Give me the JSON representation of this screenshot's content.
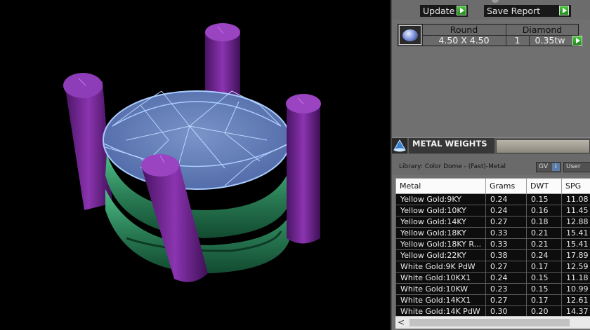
{
  "toolbar": {
    "update_label": "Update",
    "save_report_label": "Save Report"
  },
  "stone": {
    "shape": "Round",
    "type": "Diamond",
    "size": "4.50 X 4.50",
    "quantity": "1",
    "weight": "0.35tw"
  },
  "metal_weights": {
    "tab_title": "METAL WEIGHTS",
    "library_label": "Library: Color Dome - (Fast)-Metal",
    "gv_label": "GV",
    "user_label": "User",
    "info_glyph": "i",
    "columns": [
      "Metal",
      "Grams",
      "DWT",
      "SPG"
    ],
    "rows": [
      {
        "metal": "Yellow Gold:9KY",
        "grams": "0.24",
        "dwt": "0.15",
        "spg": "11.08"
      },
      {
        "metal": "Yellow Gold:10KY",
        "grams": "0.24",
        "dwt": "0.16",
        "spg": "11.45"
      },
      {
        "metal": "Yellow Gold:14KY",
        "grams": "0.27",
        "dwt": "0.18",
        "spg": "12.88"
      },
      {
        "metal": "Yellow Gold:18KY",
        "grams": "0.33",
        "dwt": "0.21",
        "spg": "15.41"
      },
      {
        "metal": "Yellow Gold:18KY R...",
        "grams": "0.33",
        "dwt": "0.21",
        "spg": "15.41"
      },
      {
        "metal": "Yellow Gold:22KY",
        "grams": "0.38",
        "dwt": "0.24",
        "spg": "17.89"
      },
      {
        "metal": "White Gold:9K PdW",
        "grams": "0.27",
        "dwt": "0.17",
        "spg": "12.59"
      },
      {
        "metal": "White Gold:10KX1",
        "grams": "0.24",
        "dwt": "0.15",
        "spg": "11.18"
      },
      {
        "metal": "White Gold:10KW",
        "grams": "0.23",
        "dwt": "0.15",
        "spg": "10.99"
      },
      {
        "metal": "White Gold:14KX1",
        "grams": "0.27",
        "dwt": "0.17",
        "spg": "12.61"
      },
      {
        "metal": "White Gold:14K PdW",
        "grams": "0.30",
        "dwt": "0.20",
        "spg": "14.37"
      }
    ]
  },
  "colors": {
    "prong": "#7a2a9c",
    "shank": "#2f8a5e",
    "stone_wire": "#9ec2ff",
    "go_button": "#2fa828"
  },
  "scrollbar": {
    "left_arrow": "<"
  }
}
